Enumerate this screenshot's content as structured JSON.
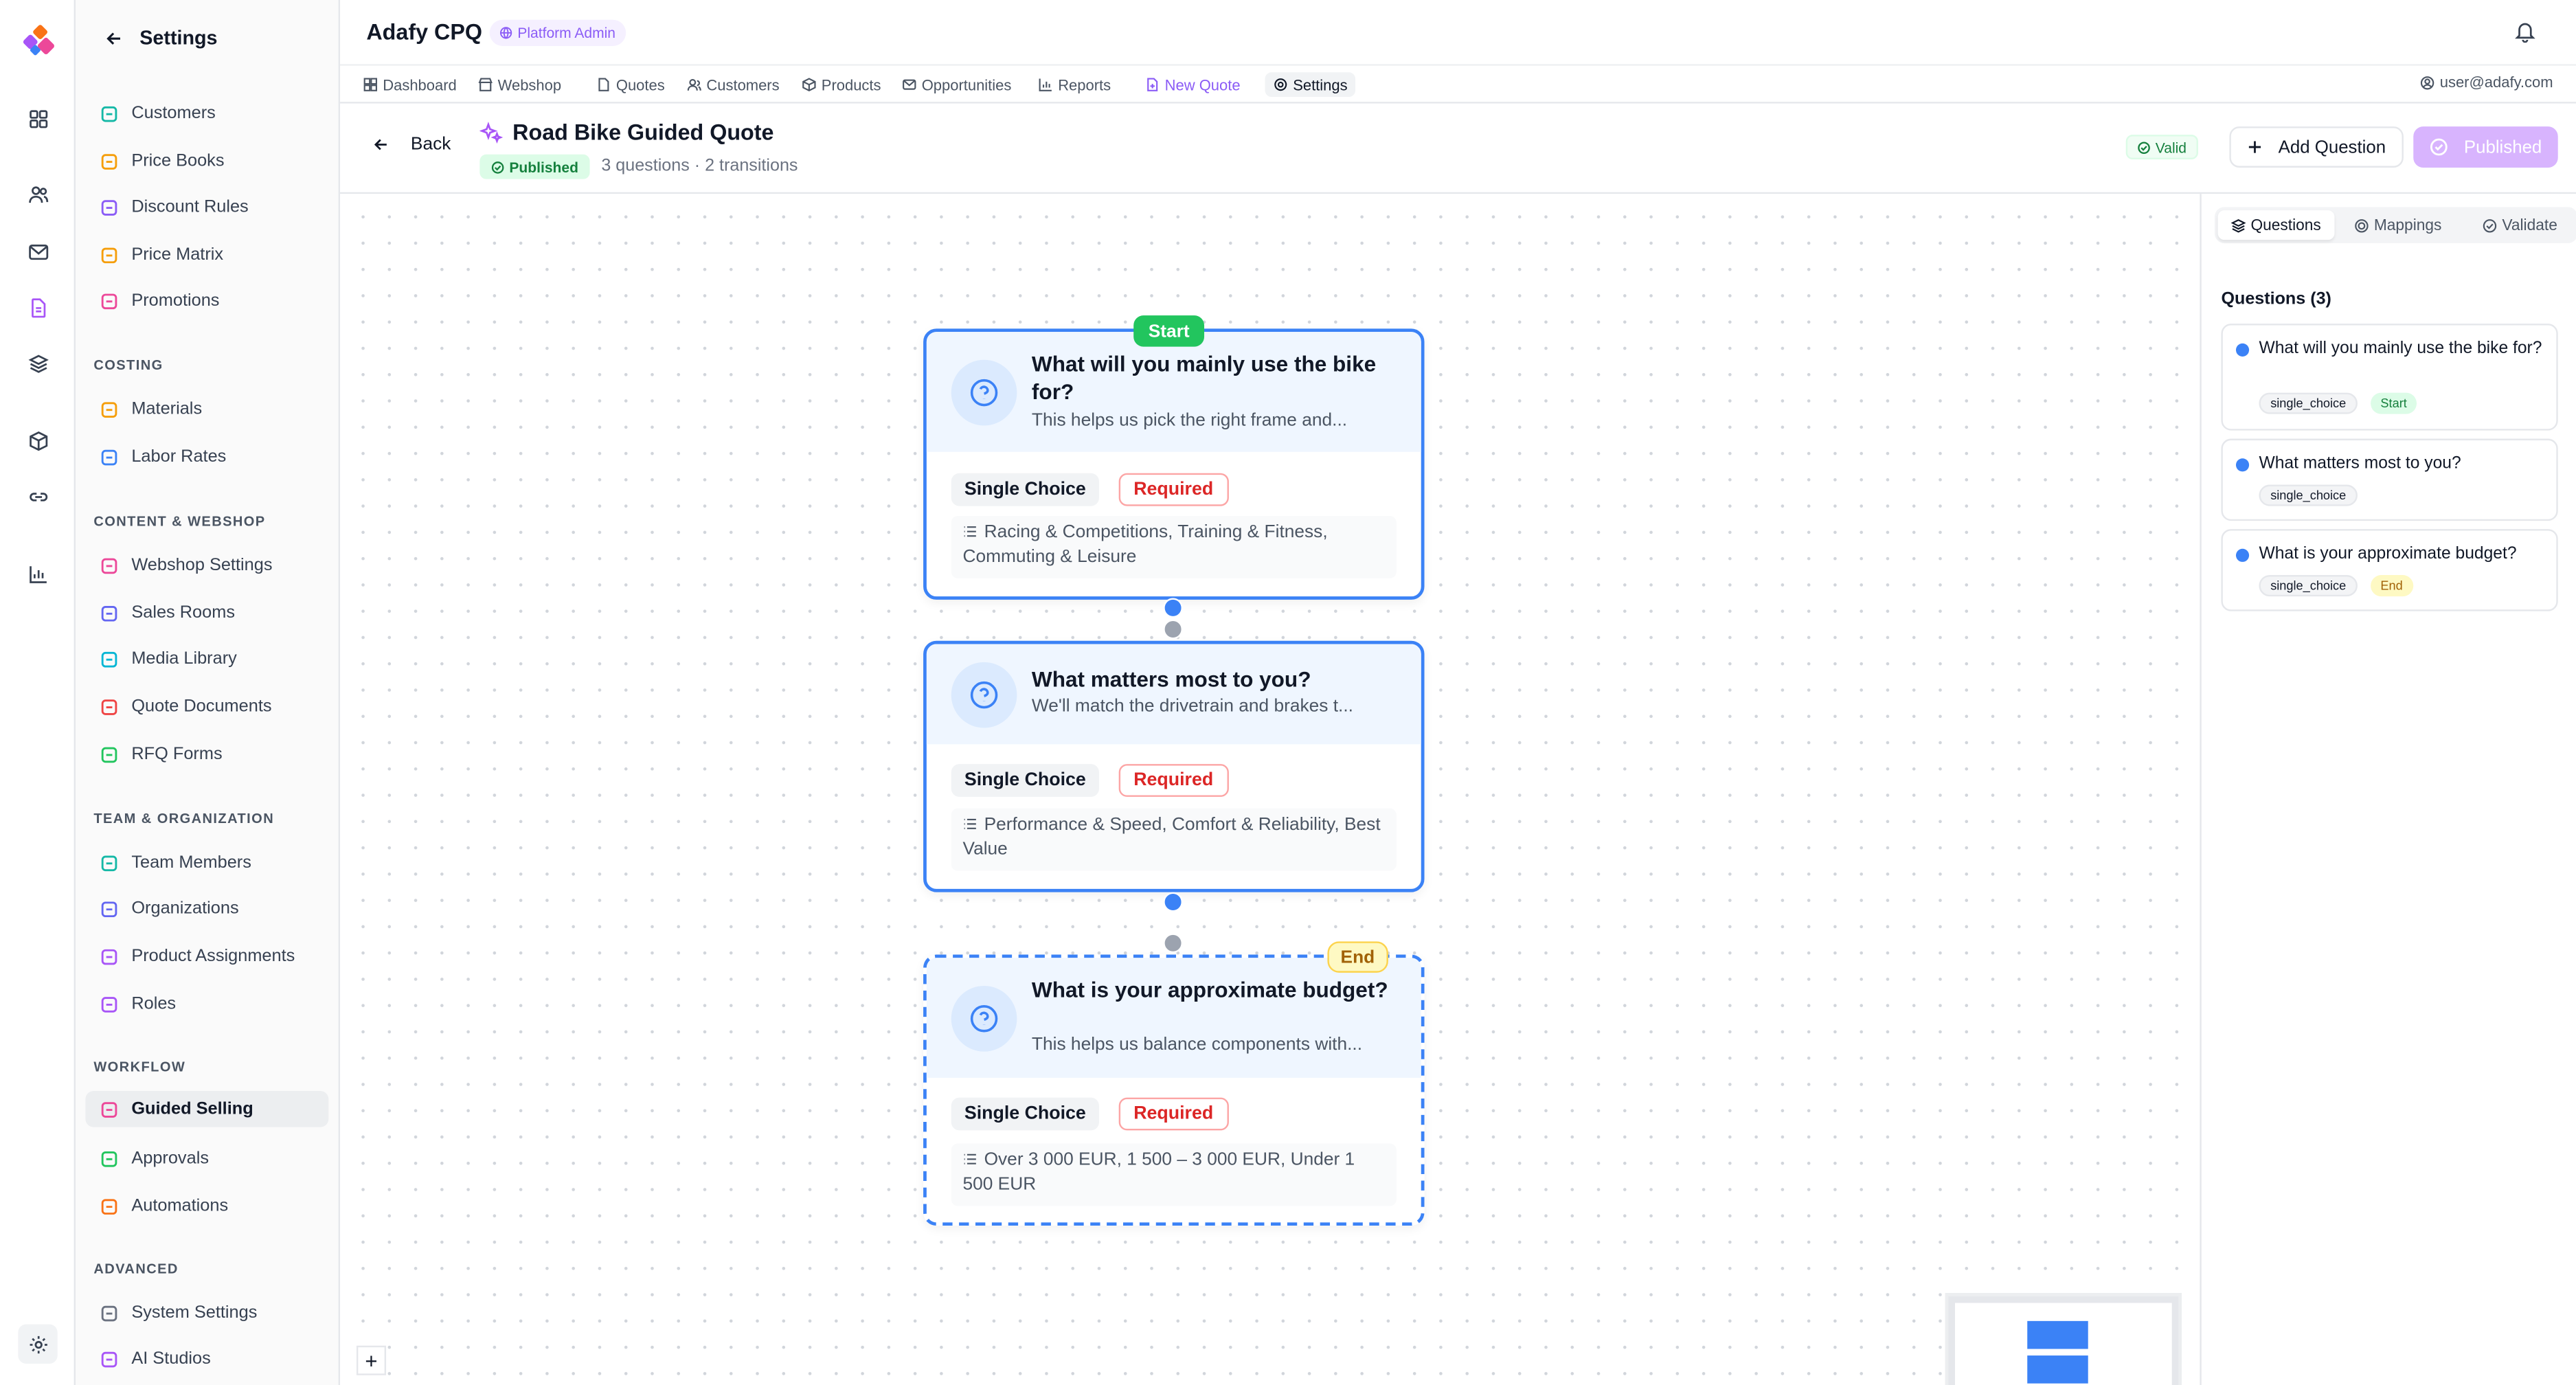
{
  "app": {
    "title": "Adafy CPQ",
    "role_badge": "Platform Admin",
    "user": "user@adafy.com"
  },
  "nav": [
    {
      "label": "Dashboard",
      "icon": "dashboard-icon"
    },
    {
      "label": "Webshop",
      "icon": "store-icon"
    },
    {
      "label": "Quotes",
      "icon": "file-icon"
    },
    {
      "label": "Customers",
      "icon": "users-icon"
    },
    {
      "label": "Products",
      "icon": "box-icon"
    },
    {
      "label": "Opportunities",
      "icon": "mail-icon"
    },
    {
      "label": "Reports",
      "icon": "chart-icon"
    },
    {
      "label": "New Quote",
      "icon": "file-plus-icon"
    },
    {
      "label": "Settings",
      "icon": "gear-icon"
    }
  ],
  "settings": {
    "title": "Settings",
    "items_top": [
      {
        "label": "Customers",
        "color": "#14b8a6"
      },
      {
        "label": "Price Books",
        "color": "#f59e0b"
      },
      {
        "label": "Discount Rules",
        "color": "#8b5cf6"
      },
      {
        "label": "Price Matrix",
        "color": "#f59e0b"
      },
      {
        "label": "Promotions",
        "color": "#ec4899"
      }
    ],
    "section_costing": "COSTING",
    "items_costing": [
      {
        "label": "Materials",
        "color": "#f59e0b"
      },
      {
        "label": "Labor Rates",
        "color": "#3b82f6"
      }
    ],
    "section_content": "CONTENT & WEBSHOP",
    "items_content": [
      {
        "label": "Webshop Settings",
        "color": "#ec4899"
      },
      {
        "label": "Sales Rooms",
        "color": "#6366f1"
      },
      {
        "label": "Media Library",
        "color": "#06b6d4"
      },
      {
        "label": "Quote Documents",
        "color": "#ef4444"
      },
      {
        "label": "RFQ Forms",
        "color": "#22c55e"
      }
    ],
    "section_team": "TEAM & ORGANIZATION",
    "items_team": [
      {
        "label": "Team Members",
        "color": "#14b8a6"
      },
      {
        "label": "Organizations",
        "color": "#6366f1"
      },
      {
        "label": "Product Assignments",
        "color": "#a855f7"
      },
      {
        "label": "Roles",
        "color": "#a855f7"
      }
    ],
    "section_workflow": "WORKFLOW",
    "items_workflow": [
      {
        "label": "Guided Selling",
        "color": "#ec4899",
        "active": true
      },
      {
        "label": "Approvals",
        "color": "#22c55e"
      },
      {
        "label": "Automations",
        "color": "#f97316"
      }
    ],
    "section_advanced": "ADVANCED",
    "items_advanced": [
      {
        "label": "System Settings",
        "color": "#6b7280"
      },
      {
        "label": "AI Studios",
        "color": "#a855f7"
      }
    ]
  },
  "header": {
    "back_label": "Back",
    "title": "Road Bike Guided Quote",
    "status": "Published",
    "meta": "3 questions · 2 transitions",
    "valid_label": "Valid",
    "add_question_label": "Add Question",
    "publish_label": "Published"
  },
  "nodes": [
    {
      "title": "What will you mainly use the bike for?",
      "description": "This helps us pick the right frame and...",
      "type": "Single Choice",
      "required": "Required",
      "options": "Racing & Competitions, Training & Fitness, Commuting & Leisure",
      "badge": "Start"
    },
    {
      "title": "What matters most to you?",
      "description": "We'll match the drivetrain and brakes t...",
      "type": "Single Choice",
      "required": "Required",
      "options": "Performance & Speed, Comfort & Reliability, Best Value"
    },
    {
      "title": "What is your approximate budget?",
      "description": "This helps us balance components with...",
      "type": "Single Choice",
      "required": "Required",
      "options": "Over 3 000 EUR, 1 500 – 3 000 EUR, Under 1 500 EUR",
      "badge": "End"
    }
  ],
  "canvas": {
    "zoom_in_label": "+"
  },
  "panel": {
    "tabs": [
      "Questions",
      "Mappings",
      "Validate"
    ],
    "count_label": "Questions (3)",
    "questions": [
      {
        "title": "What will you mainly use the bike for?",
        "type": "single_choice",
        "badge": "Start"
      },
      {
        "title": "What matters most to you?",
        "type": "single_choice"
      },
      {
        "title": "What is your approximate budget?",
        "type": "single_choice",
        "badge": "End"
      }
    ]
  }
}
